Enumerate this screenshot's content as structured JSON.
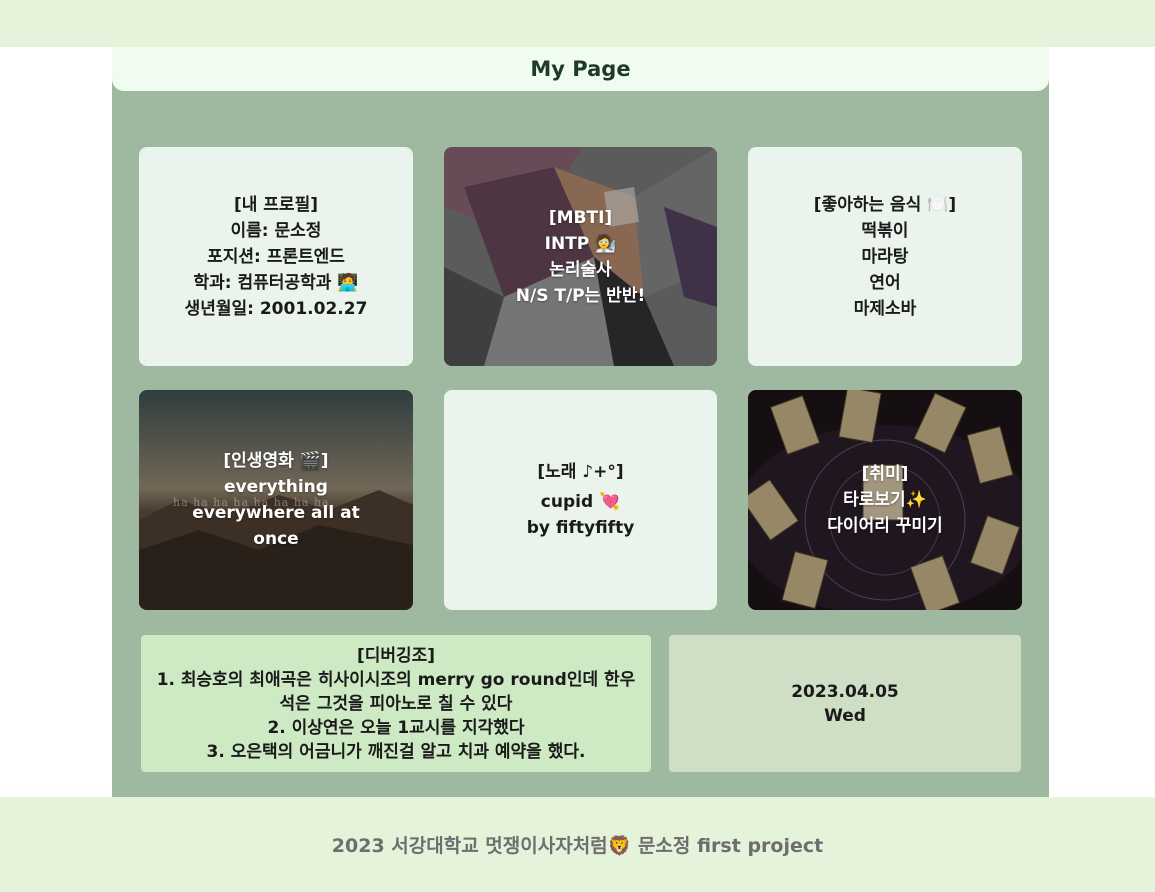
{
  "page": {
    "title": "My Page"
  },
  "cards": {
    "profile": {
      "heading": "[내 프로필]",
      "lines": [
        "이름: 문소정",
        "포지션: 프론트엔드",
        "학과: 컴퓨터공학과 🧑‍💻",
        "생년월일: 2001.02.27"
      ]
    },
    "mbti": {
      "heading": "[MBTI]",
      "lines": [
        "INTP 🧑‍🔬",
        "논리술사",
        "N/S T/P는 반반!"
      ]
    },
    "food": {
      "heading": "[좋아하는 음식 🍽️]",
      "lines": [
        "떡볶이",
        "마라탕",
        "연어",
        "마제소바"
      ]
    },
    "movie": {
      "heading": "[인생영화 🎬]",
      "lines": [
        "everything",
        "everywhere all at",
        "once"
      ],
      "watermark": "ha ha ha ha ha ha ha ha"
    },
    "song": {
      "heading": "[노래 ♪+°]",
      "lines": [
        "cupid 💘",
        "by fiftyfifty"
      ]
    },
    "hobby": {
      "heading": "[취미]",
      "lines": [
        "타로보기✨",
        "다이어리 꾸미기"
      ]
    }
  },
  "debugging": {
    "heading": "[디버깅조]",
    "lines": [
      "1. 최승호의 최애곡은 히사이시조의 merry go round인데 한우",
      "석은 그것을 피아노로 칠 수 있다",
      "2. 이상연은 오늘 1교시를 지각했다",
      "3. 오은택의 어금니가 깨진걸 알고 치과 예약을 했다."
    ]
  },
  "date": {
    "date": "2023.04.05",
    "weekday": "Wed"
  },
  "footer": {
    "text": "2023 서강대학교 멋쟁이사자처럼🦁 문소정 first project"
  },
  "colors": {
    "background_band": "#e6f3db",
    "panel": "#9fb8a0",
    "title_bar": "#effcef",
    "card_light": "#eaf4ec",
    "debug_card": "#cdeac4",
    "date_card": "#cfdfc6"
  }
}
